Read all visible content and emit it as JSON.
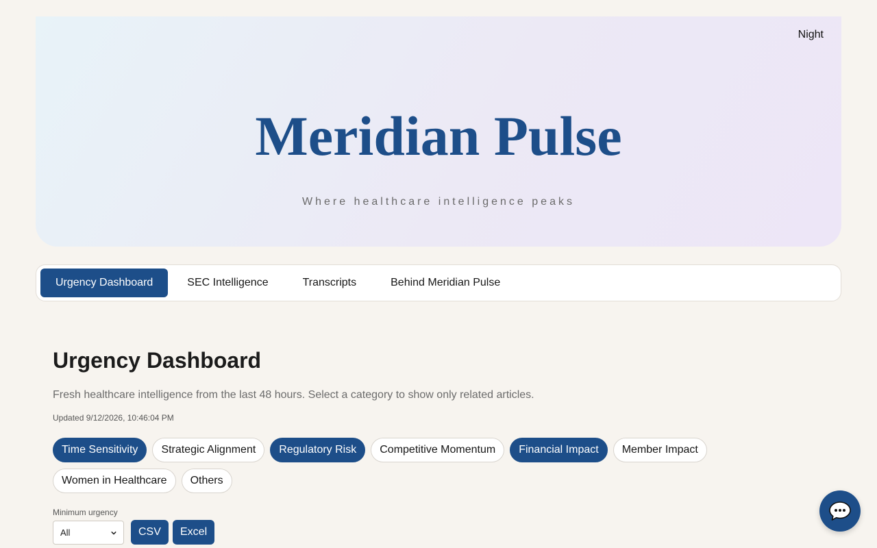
{
  "header": {
    "theme_toggle_label": "Night",
    "title": "Meridian Pulse",
    "tagline": "Where healthcare intelligence peaks"
  },
  "nav": {
    "tabs": [
      {
        "label": "Urgency Dashboard",
        "active": true
      },
      {
        "label": "SEC Intelligence",
        "active": false
      },
      {
        "label": "Transcripts",
        "active": false
      },
      {
        "label": "Behind Meridian Pulse",
        "active": false
      }
    ]
  },
  "dashboard": {
    "title": "Urgency Dashboard",
    "description": "Fresh healthcare intelligence from the last 48 hours. Select a category to show only related articles.",
    "updated": "Updated 9/12/2026, 10:46:04 PM",
    "categories": [
      {
        "label": "Time Sensitivity",
        "selected": true
      },
      {
        "label": "Strategic Alignment",
        "selected": false
      },
      {
        "label": "Regulatory Risk",
        "selected": true
      },
      {
        "label": "Competitive Momentum",
        "selected": false
      },
      {
        "label": "Financial Impact",
        "selected": true
      },
      {
        "label": "Member Impact",
        "selected": false
      },
      {
        "label": "Women in Healthcare",
        "selected": false
      },
      {
        "label": "Others",
        "selected": false
      }
    ],
    "min_urgency": {
      "label": "Minimum urgency",
      "selected_value": "All"
    },
    "export": {
      "csv_label": "CSV",
      "excel_label": "Excel"
    }
  },
  "chat_fab": {
    "icon": "chat-bubble-icon"
  },
  "colors": {
    "brand": "#1d4e89",
    "background": "#f7f4ef"
  }
}
